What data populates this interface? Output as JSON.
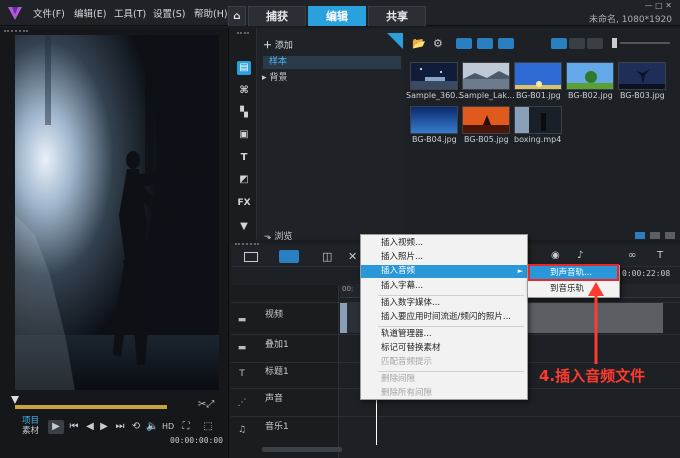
{
  "app": {
    "menu": [
      "文件(F)",
      "编辑(E)",
      "工具(T)",
      "设置(S)",
      "帮助(H)"
    ],
    "tabs": [
      {
        "label": "捕获",
        "active": false
      },
      {
        "label": "编辑",
        "active": true
      },
      {
        "label": "共享",
        "active": false
      }
    ],
    "project_info": "未命名, 1080*1920",
    "window_controls": "— □ ✕",
    "accent_color": "#2aa0dc"
  },
  "player": {
    "mode_project": "项目",
    "mode_clip": "素材",
    "timecode": "00:00:00:00",
    "icons": [
      "play-icon",
      "rewind-start-icon",
      "step-back-icon",
      "step-forward-icon",
      "go-end-icon",
      "repeat-icon",
      "volume-icon",
      "hd-icon",
      "scissors-icon",
      "expand-icon"
    ]
  },
  "library": {
    "add_label": "添加",
    "tree": [
      {
        "label": "样本",
        "selected": true
      },
      {
        "label": "背景",
        "selected": false
      }
    ],
    "browse_label": "浏览",
    "side_labels": {
      "title": "T",
      "fx": "FX"
    },
    "thumbnails": [
      {
        "label": "Sample_360...",
        "scene": "night-sky"
      },
      {
        "label": "Sample_Lak...",
        "scene": "lake-mist"
      },
      {
        "label": "BG-B01.jpg",
        "scene": "blue-sky"
      },
      {
        "label": "BG-B02.jpg",
        "scene": "green-tree"
      },
      {
        "label": "BG-B03.jpg",
        "scene": "dark-tree"
      },
      {
        "label": "BG-B04.jpg",
        "scene": "blue-gradient"
      },
      {
        "label": "BG-B05.jpg",
        "scene": "orange-sunset"
      },
      {
        "label": "boxing.mp4",
        "scene": "boxing"
      }
    ]
  },
  "timeline": {
    "timecode": "0:00:22:08",
    "tracks": [
      {
        "name": "视频",
        "icon": "video-track-icon"
      },
      {
        "name": "叠加1",
        "icon": "overlay-track-icon"
      },
      {
        "name": "标题1",
        "icon": "title-track-icon"
      },
      {
        "name": "声音",
        "icon": "voice-track-icon"
      },
      {
        "name": "音乐1",
        "icon": "music-track-icon"
      }
    ],
    "ruler_start": "00:"
  },
  "context_menu": {
    "items": [
      {
        "label": "插入视频...",
        "enabled": true,
        "highlighted": false
      },
      {
        "label": "插入照片...",
        "enabled": true,
        "highlighted": false
      },
      {
        "label": "插入音频",
        "enabled": true,
        "highlighted": true,
        "submenu_arrow": "►"
      },
      {
        "label": "插入字幕...",
        "enabled": true,
        "highlighted": false
      },
      {
        "label": "插入数字媒体...",
        "enabled": true,
        "highlighted": false
      },
      {
        "label": "插入要应用时间流逝/频闪的照片...",
        "enabled": true,
        "highlighted": false
      },
      {
        "label": "轨道管理器...",
        "enabled": true,
        "highlighted": false
      },
      {
        "label": "标记可替换素材",
        "enabled": true,
        "highlighted": false
      },
      {
        "label": "匹配音频提示",
        "enabled": false,
        "highlighted": false
      },
      {
        "label": "删除间隙",
        "enabled": false,
        "highlighted": false
      },
      {
        "label": "删除所有间隙",
        "enabled": false,
        "highlighted": false
      }
    ],
    "submenu": [
      {
        "label": "到声音轨...",
        "highlighted": true
      },
      {
        "label": "到音乐轨",
        "highlighted": false
      }
    ]
  },
  "annotation": {
    "text": "4.插入音频文件",
    "color": "#ff3a2f"
  }
}
